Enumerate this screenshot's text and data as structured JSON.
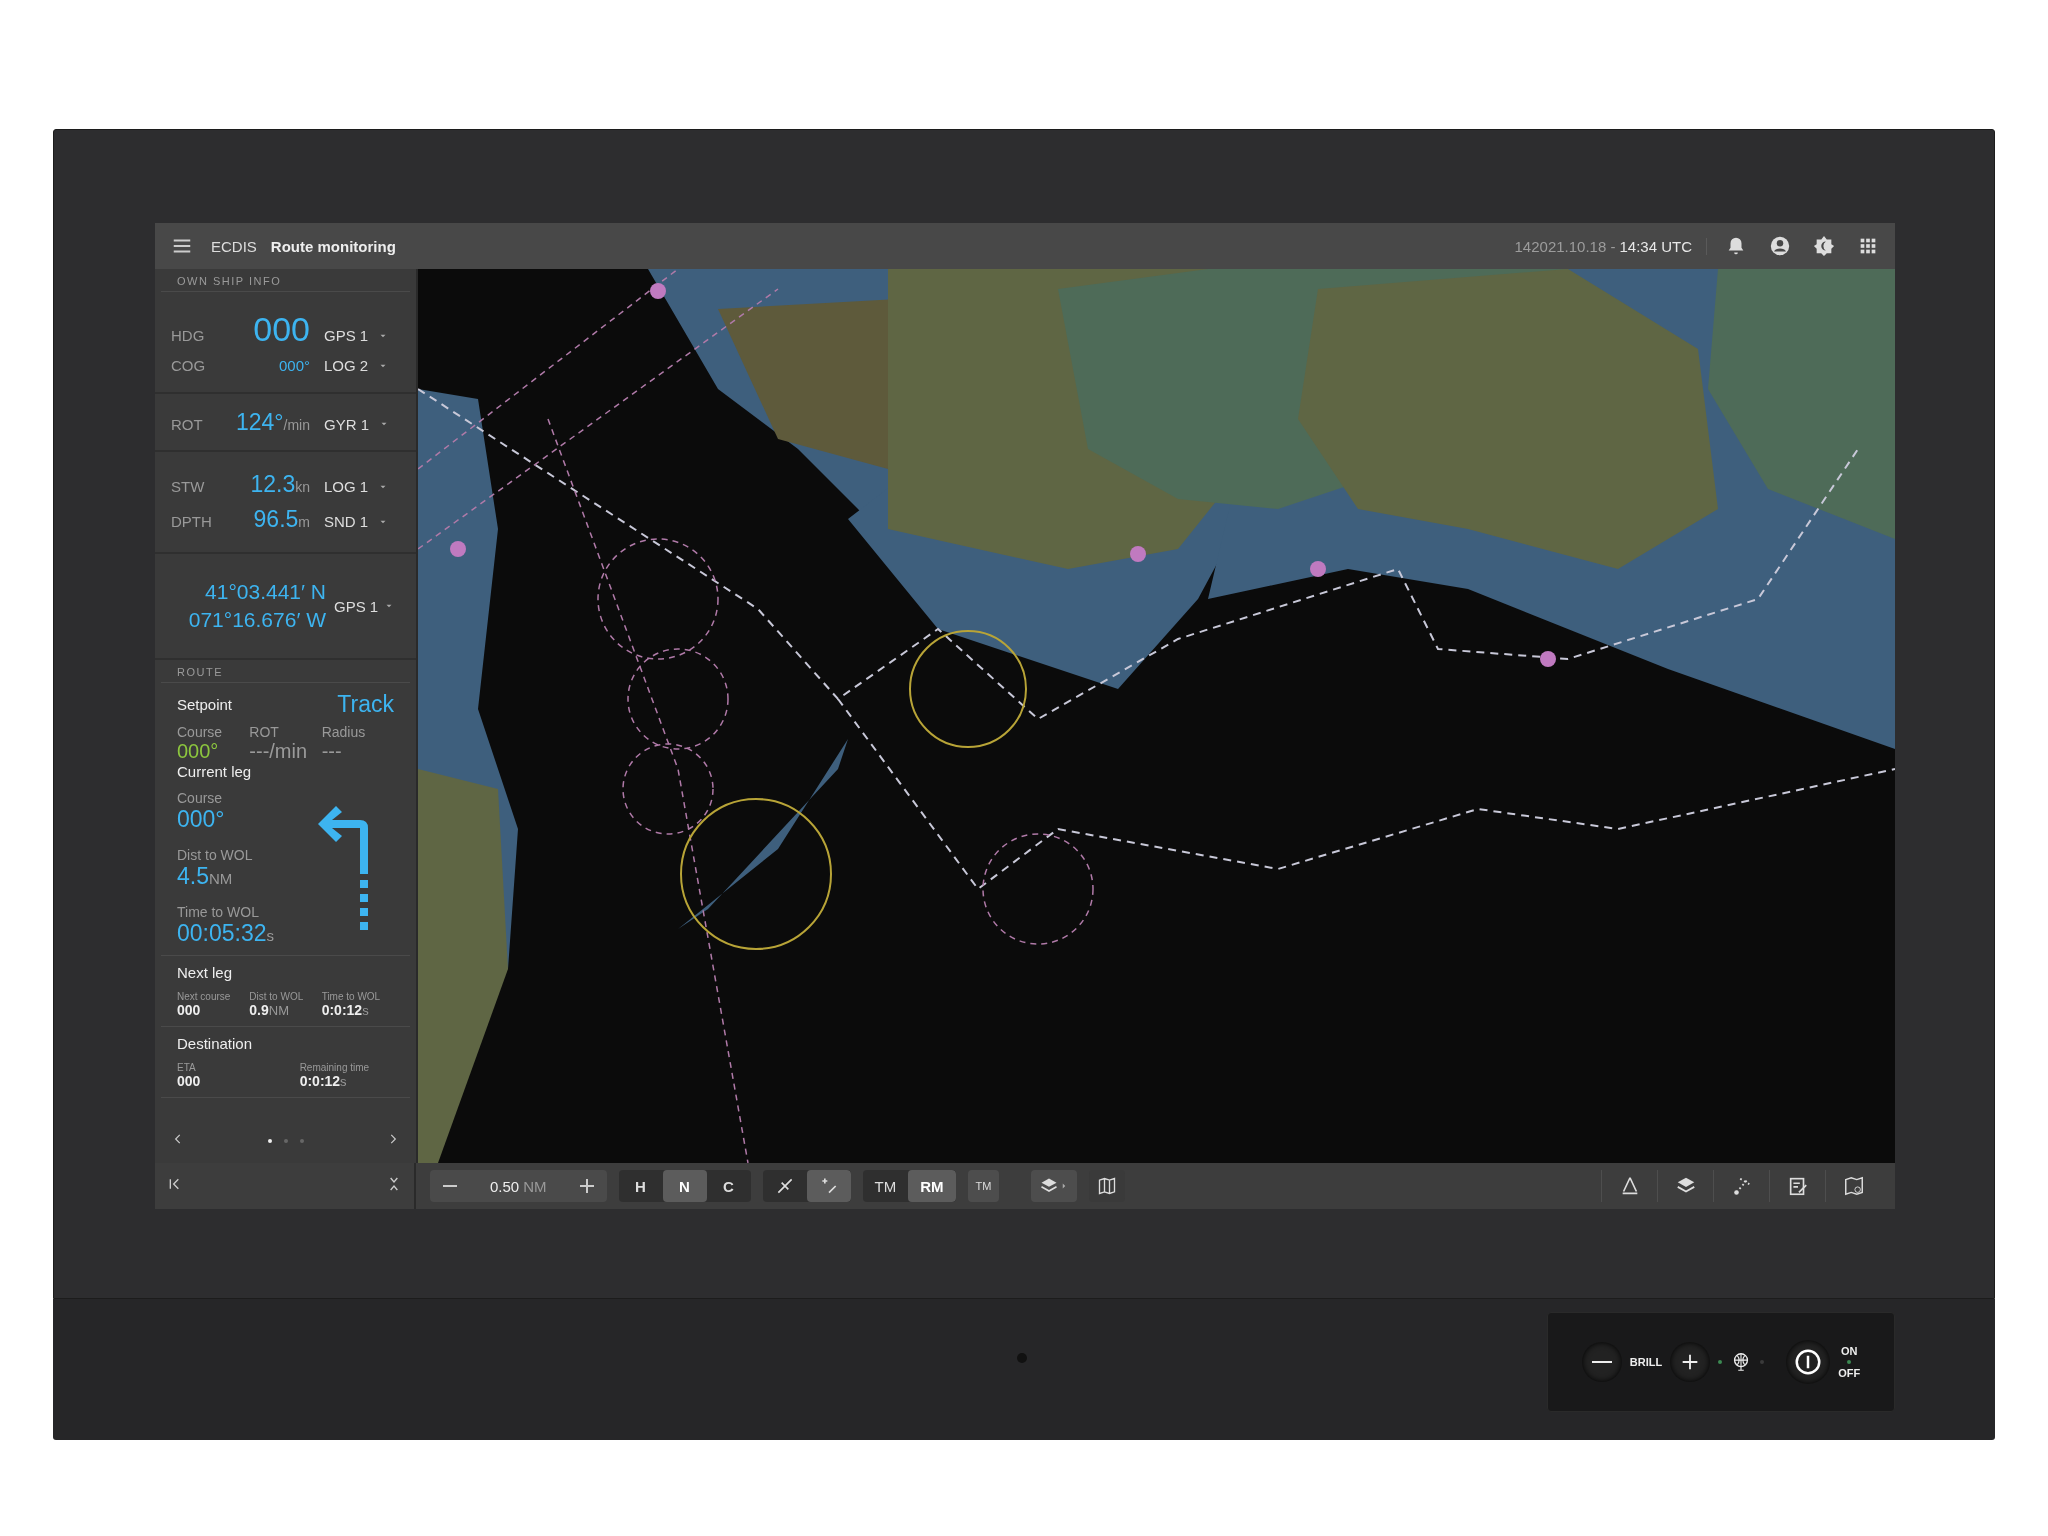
{
  "topbar": {
    "app": "ECDIS",
    "title": "Route monitoring",
    "date": "142021.10.18 -",
    "time": "14:34 UTC"
  },
  "own_ship_info": {
    "heading": "OWN SHIP INFO",
    "groups": [
      [
        {
          "kind": "large",
          "label": "HDG",
          "value": "000",
          "source": "GPS 1"
        },
        {
          "kind": "small",
          "label": "COG",
          "value": "000°",
          "source": "LOG 2"
        }
      ],
      [
        {
          "kind": "medium",
          "label": "ROT",
          "value": "124°",
          "unit": "/min",
          "source": "GYR 1"
        }
      ],
      [
        {
          "kind": "medium",
          "label": "STW",
          "value": "12.3",
          "unit": "kn",
          "source": "LOG 1"
        },
        {
          "kind": "medium",
          "label": "DPTH",
          "value": "96.5",
          "unit": "m",
          "source": "SND 1"
        }
      ]
    ],
    "position": {
      "lat": "41°03.441′ N",
      "lon": "071°16.676′ W",
      "source": "GPS 1"
    }
  },
  "route": {
    "heading": "ROUTE",
    "setpoint": {
      "label": "Setpoint",
      "mode": "Track",
      "items": [
        {
          "label": "Course",
          "value": "000°",
          "color": "#8cc63e"
        },
        {
          "label": "ROT",
          "value": "---/min",
          "color": "#9a9a9a"
        },
        {
          "label": "Radius",
          "value": "---",
          "color": "#9a9a9a"
        }
      ]
    },
    "current_leg": {
      "label": "Current leg",
      "items": [
        {
          "label": "Course",
          "value": "000°"
        },
        {
          "label": "Dist to WOL",
          "value": "4.5",
          "unit": "NM"
        },
        {
          "label": "Time to WOL",
          "value": "00:05:32",
          "unit": "s"
        }
      ]
    },
    "next_leg": {
      "label": "Next leg",
      "items": [
        {
          "label": "Next course",
          "value": "000"
        },
        {
          "label": "Dist to WOL",
          "value": "0.9",
          "unit": "NM"
        },
        {
          "label": "Time to WOL",
          "value": "0:0:12",
          "unit": "s"
        }
      ]
    },
    "destination": {
      "label": "Destination",
      "items": [
        {
          "label": "ETA",
          "value": "000"
        },
        {
          "label": "Remaining time",
          "value": "0:0:12",
          "unit": "s"
        }
      ]
    }
  },
  "pager": [
    {
      "selected": true
    },
    {
      "selected": false
    },
    {
      "selected": false
    }
  ],
  "toolbar": {
    "scale": "0.50",
    "scale_unit": "NM",
    "orientation": [
      {
        "label": "H",
        "selected": false
      },
      {
        "label": "N",
        "selected": true
      },
      {
        "label": "C",
        "selected": false
      }
    ],
    "cursor_tools": [
      {
        "selected": false
      },
      {
        "selected": true
      }
    ],
    "motion": [
      {
        "label": "TM",
        "selected": false
      },
      {
        "label": "RM",
        "selected": true
      }
    ],
    "reset_label": "TM"
  },
  "hardware": {
    "brill_label": "BRILL",
    "on_label": "ON",
    "off_label": "OFF"
  }
}
